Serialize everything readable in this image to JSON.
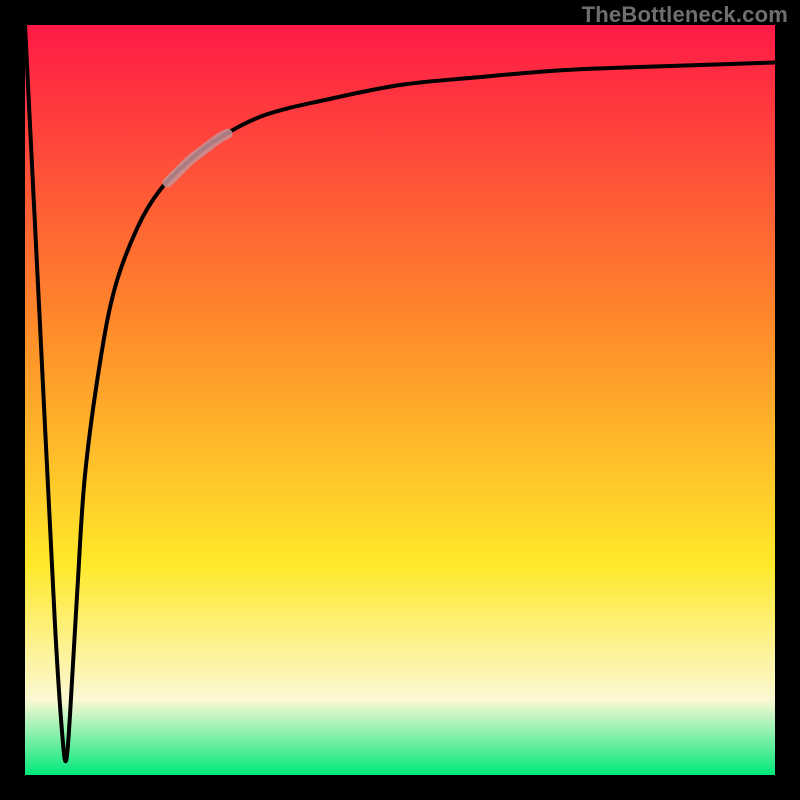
{
  "watermark": "TheBottleneck.com",
  "colors": {
    "frame": "#000000",
    "curve": "#000000",
    "highlight": "#c59398",
    "watermark": "#6f6f6f",
    "gradient_top": "#ff1a46",
    "gradient_mid1": "#ff8a2a",
    "gradient_mid2": "#ffe92a",
    "gradient_band": "#fbf8d4",
    "gradient_bottom": "#00e87a"
  },
  "chart_data": {
    "type": "line",
    "title": "",
    "xlabel": "",
    "ylabel": "",
    "xlim": [
      0,
      100
    ],
    "ylim": [
      0,
      100
    ],
    "x": [
      0,
      2,
      4,
      5,
      5.5,
      6,
      7,
      8,
      10,
      12,
      15,
      18,
      22,
      26,
      32,
      40,
      50,
      60,
      72,
      85,
      100
    ],
    "values": [
      100,
      60,
      20,
      5,
      2,
      8,
      25,
      40,
      55,
      65,
      73,
      78,
      82,
      85,
      88,
      90,
      92,
      93,
      94,
      94.5,
      95
    ],
    "highlight_range_x": [
      19,
      27
    ],
    "annotations": []
  }
}
